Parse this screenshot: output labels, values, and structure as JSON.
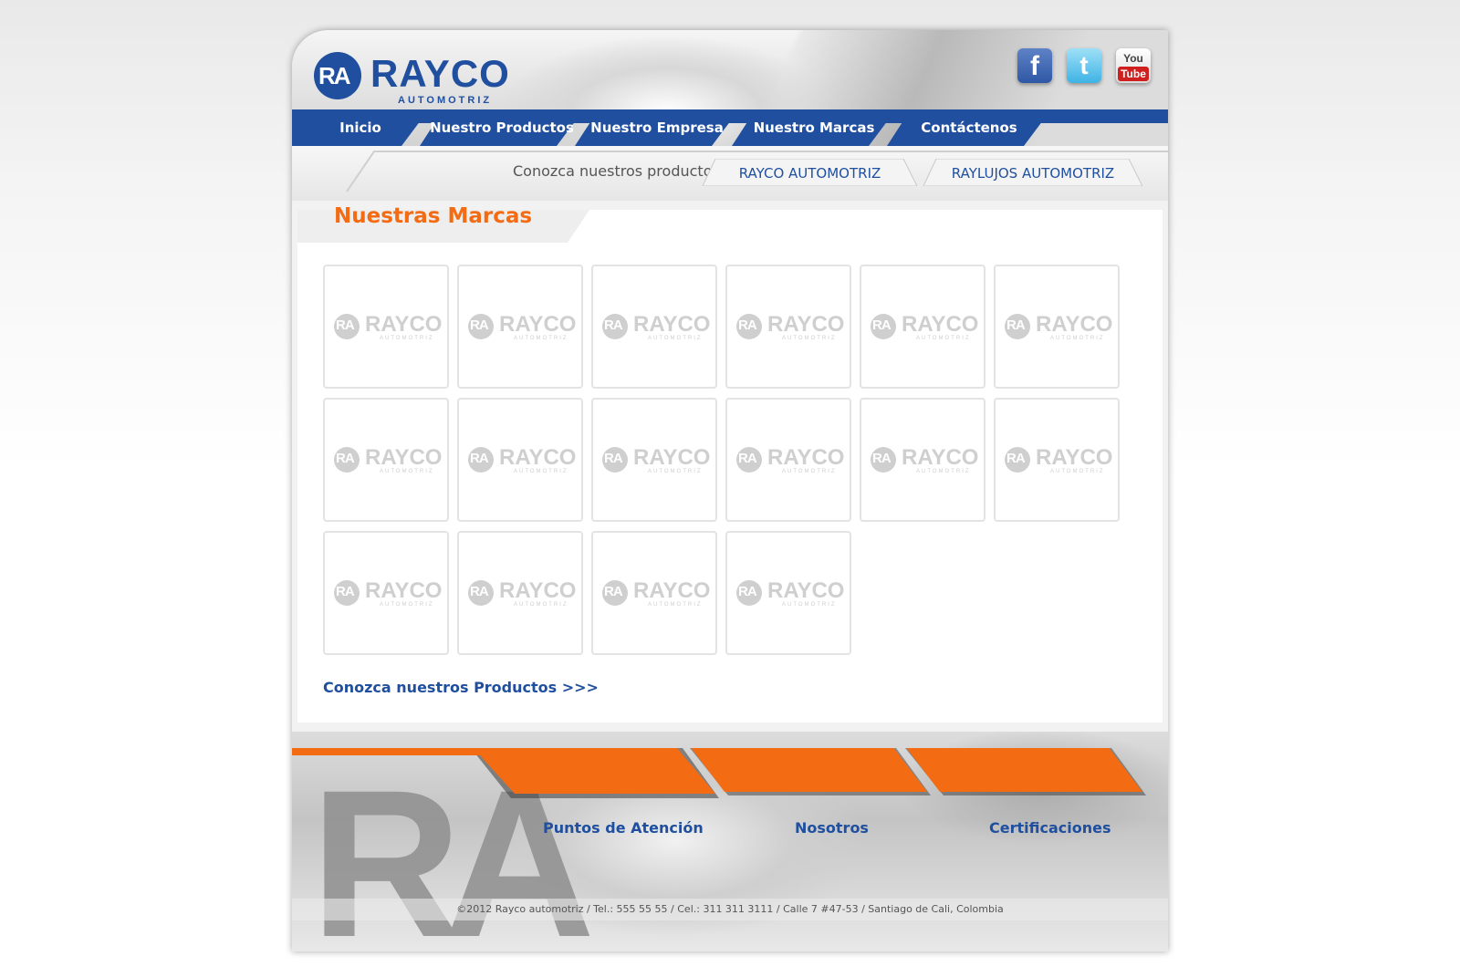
{
  "brand": {
    "logo_mark": "RA",
    "logo_word": "RAYCO",
    "logo_sub": "AUTOMOTRIZ"
  },
  "social": [
    {
      "icon": "facebook-icon",
      "glyph": "f"
    },
    {
      "icon": "twitter-icon",
      "glyph": "t"
    },
    {
      "icon": "youtube-icon",
      "glyph_top": "You",
      "glyph_bottom": "Tube"
    }
  ],
  "nav": {
    "items": [
      {
        "label": "Inicio"
      },
      {
        "label": "Nuestro Productos"
      },
      {
        "label": "Nuestro Empresa"
      },
      {
        "label": "Nuestro Marcas"
      },
      {
        "label": "Contáctenos"
      }
    ]
  },
  "subnav": {
    "label": "Conozca nuestros productos:",
    "links": [
      {
        "label": "RAYCO AUTOMOTRIZ"
      },
      {
        "label": "RAYLUJOS AUTOMOTRIZ"
      }
    ]
  },
  "main": {
    "title": "Nuestras Marcas",
    "brand_tile": {
      "mark": "RA",
      "word": "RAYCO",
      "sub": "AUTOMOTRIZ"
    },
    "brand_count": 16,
    "more_link": "Conozca nuestros Productos >>>"
  },
  "footer": {
    "watermark": "RA",
    "links": [
      {
        "label": "Puntos de Atención"
      },
      {
        "label": "Nosotros"
      },
      {
        "label": "Certificaciones"
      }
    ],
    "copyright": "©2012 Rayco automotriz / Tel.: 555 55 55 / Cel.: 311 311 3111 / Calle 7 #47-53 / Santiago de Cali, Colombia"
  },
  "colors": {
    "primary_blue": "#1f4f9e",
    "accent_orange": "#f36b12"
  }
}
